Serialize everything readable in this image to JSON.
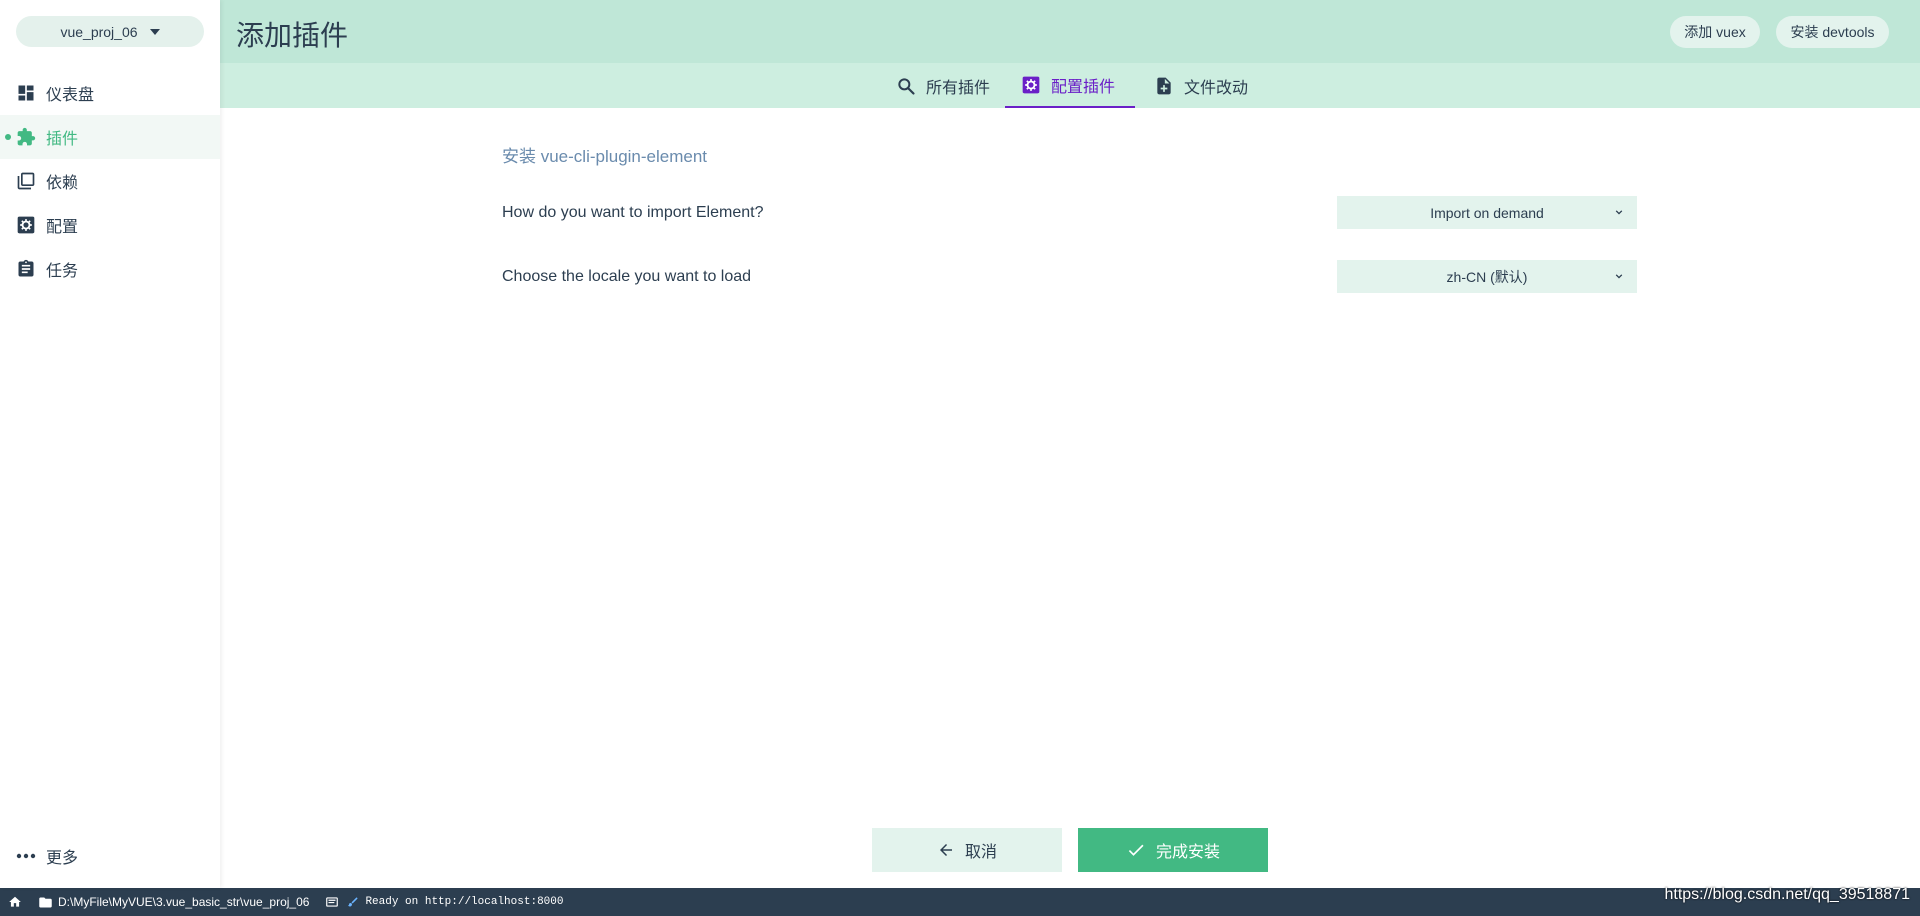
{
  "sidebar": {
    "project": "vue_proj_06",
    "items": [
      {
        "label": "仪表盘",
        "icon": "dashboard-icon"
      },
      {
        "label": "插件",
        "icon": "puzzle-icon"
      },
      {
        "label": "依赖",
        "icon": "library-icon"
      },
      {
        "label": "配置",
        "icon": "settings-icon"
      },
      {
        "label": "任务",
        "icon": "clipboard-icon"
      }
    ],
    "more": "更多"
  },
  "header": {
    "title": "添加插件",
    "add_vuex": "添加 vuex",
    "install_devtools": "安装 devtools"
  },
  "tabs": [
    {
      "label": "所有插件",
      "icon": "search-icon"
    },
    {
      "label": "配置插件",
      "icon": "settings-icon"
    },
    {
      "label": "文件改动",
      "icon": "file-plus-icon"
    }
  ],
  "main": {
    "section_title": "安装 vue-cli-plugin-element",
    "prompts": [
      {
        "label": "How do you want to import Element?",
        "value": "Import on demand"
      },
      {
        "label": "Choose the locale you want to load",
        "value": "zh-CN (默认)"
      }
    ],
    "cancel": "取消",
    "finish": "完成安装"
  },
  "statusbar": {
    "path": "D:\\MyFile\\MyVUE\\3.vue_basic_str\\vue_proj_06",
    "log": "Ready on http://localhost:8000"
  },
  "watermark": "https://blog.csdn.net/qq_39518871",
  "colors": {
    "accent": "#42b983",
    "active_tab": "#6a1fc7",
    "header": "#bfe7d7",
    "statusbar": "#2c3e50"
  }
}
